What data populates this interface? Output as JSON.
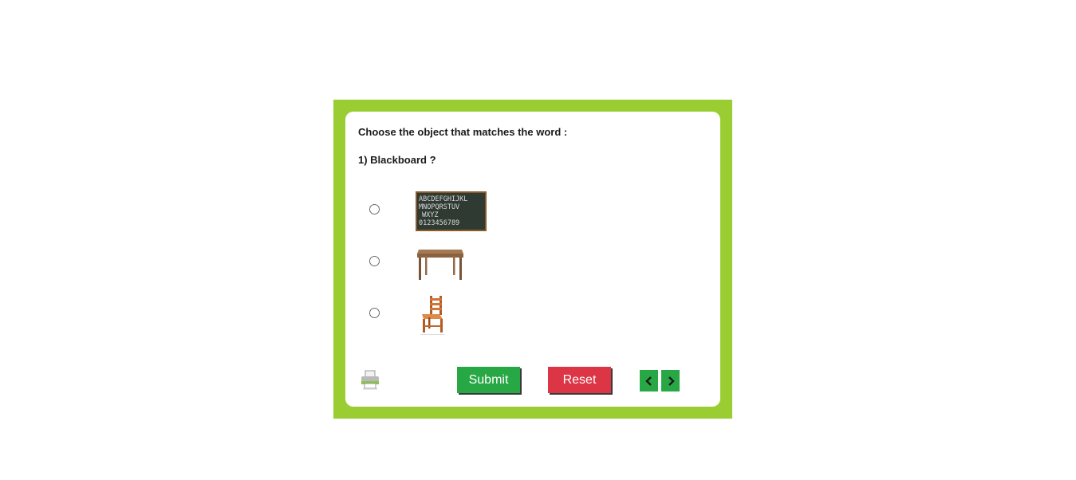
{
  "quiz": {
    "instruction": "Choose the object that matches the word :",
    "question": "1) Blackboard ?",
    "options": [
      {
        "name": "blackboard",
        "image_text": [
          "ABCDEFGHIJKL",
          "MNOPQRSTUV",
          "WXYZ",
          "0123456789"
        ]
      },
      {
        "name": "table"
      },
      {
        "name": "chair"
      }
    ]
  },
  "toolbar": {
    "submit_label": "Submit",
    "reset_label": "Reset",
    "print_icon": "printer-icon",
    "prev_icon": "chevron-left-icon",
    "next_icon": "chevron-right-icon"
  },
  "colors": {
    "frame": "#9acd32",
    "submit": "#28a745",
    "reset": "#dc3545",
    "nav": "#28a745"
  }
}
